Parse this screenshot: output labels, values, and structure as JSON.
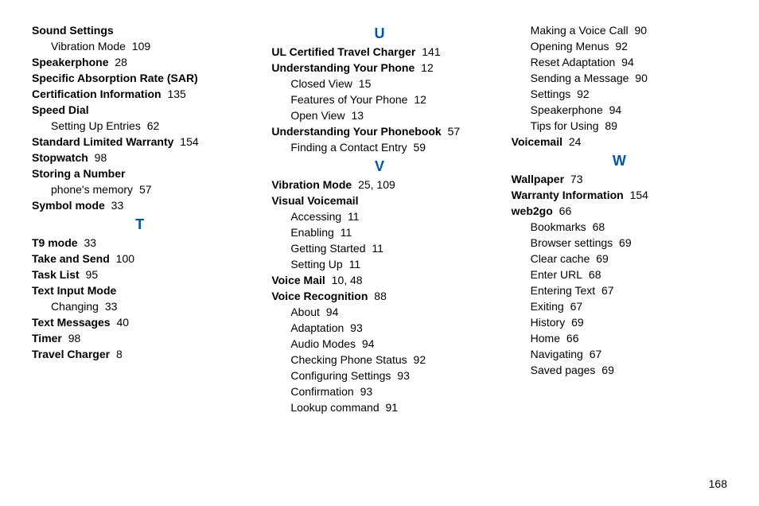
{
  "columns": [
    {
      "blocks": [
        {
          "type": "main",
          "label": "Sound Settings",
          "page": ""
        },
        {
          "type": "sub",
          "label": "Vibration Mode",
          "page": "109"
        },
        {
          "type": "main",
          "label": "Speakerphone",
          "page": "28"
        },
        {
          "type": "main",
          "label": "Specific Absorption Rate (SAR)",
          "page": ""
        },
        {
          "type": "main",
          "label": "Certification Information",
          "page": "135"
        },
        {
          "type": "main",
          "label": "Speed Dial",
          "page": ""
        },
        {
          "type": "sub",
          "label": "Setting Up Entries",
          "page": "62"
        },
        {
          "type": "main",
          "label": "Standard Limited Warranty",
          "page": "154"
        },
        {
          "type": "main",
          "label": "Stopwatch",
          "page": "98"
        },
        {
          "type": "main",
          "label": "Storing a Number",
          "page": ""
        },
        {
          "type": "sub",
          "label": "phone's memory",
          "page": "57"
        },
        {
          "type": "main",
          "label": "Symbol mode",
          "page": "33"
        },
        {
          "type": "letter",
          "label": "T"
        },
        {
          "type": "main",
          "label": "T9 mode",
          "page": "33"
        },
        {
          "type": "main",
          "label": "Take and Send",
          "page": "100"
        },
        {
          "type": "main",
          "label": "Task List",
          "page": "95"
        },
        {
          "type": "main",
          "label": "Text Input Mode",
          "page": ""
        },
        {
          "type": "sub",
          "label": "Changing",
          "page": "33"
        },
        {
          "type": "main",
          "label": "Text Messages",
          "page": "40"
        },
        {
          "type": "main",
          "label": "Timer",
          "page": "98"
        },
        {
          "type": "main",
          "label": "Travel Charger",
          "page": "8"
        }
      ]
    },
    {
      "blocks": [
        {
          "type": "letter",
          "label": "U"
        },
        {
          "type": "main",
          "label": "UL Certified Travel Charger",
          "page": "141"
        },
        {
          "type": "main",
          "label": "Understanding Your Phone",
          "page": "12"
        },
        {
          "type": "sub",
          "label": "Closed View",
          "page": "15"
        },
        {
          "type": "sub",
          "label": "Features of Your Phone",
          "page": "12"
        },
        {
          "type": "sub",
          "label": "Open View",
          "page": "13"
        },
        {
          "type": "main",
          "label": "Understanding Your Phonebook",
          "page": "57"
        },
        {
          "type": "sub",
          "label": "Finding a Contact Entry",
          "page": "59"
        },
        {
          "type": "letter",
          "label": "V"
        },
        {
          "type": "main",
          "label": "Vibration Mode",
          "page": "25,  109"
        },
        {
          "type": "main",
          "label": "Visual Voicemail",
          "page": ""
        },
        {
          "type": "sub",
          "label": "Accessing",
          "page": "11"
        },
        {
          "type": "sub",
          "label": "Enabling",
          "page": "11"
        },
        {
          "type": "sub",
          "label": "Getting Started",
          "page": "11"
        },
        {
          "type": "sub",
          "label": "Setting Up",
          "page": "11"
        },
        {
          "type": "main",
          "label": "Voice Mail",
          "page": "10,  48"
        },
        {
          "type": "main",
          "label": "Voice Recognition",
          "page": "88"
        },
        {
          "type": "sub",
          "label": "About",
          "page": "94"
        },
        {
          "type": "sub",
          "label": "Adaptation",
          "page": "93"
        },
        {
          "type": "sub",
          "label": "Audio Modes",
          "page": "94"
        },
        {
          "type": "sub",
          "label": "Checking Phone Status",
          "page": "92"
        },
        {
          "type": "sub",
          "label": "Configuring Settings",
          "page": "93"
        },
        {
          "type": "sub",
          "label": "Confirmation",
          "page": "93"
        },
        {
          "type": "sub",
          "label": "Lookup command",
          "page": "91"
        }
      ]
    },
    {
      "blocks": [
        {
          "type": "sub",
          "label": "Making a Voice Call",
          "page": "90"
        },
        {
          "type": "sub",
          "label": "Opening Menus",
          "page": "92"
        },
        {
          "type": "sub",
          "label": "Reset Adaptation",
          "page": "94"
        },
        {
          "type": "sub",
          "label": "Sending a Message",
          "page": "90"
        },
        {
          "type": "sub",
          "label": "Settings",
          "page": "92"
        },
        {
          "type": "sub",
          "label": "Speakerphone",
          "page": "94"
        },
        {
          "type": "sub",
          "label": "Tips for Using",
          "page": "89"
        },
        {
          "type": "main",
          "label": "Voicemail",
          "page": "24"
        },
        {
          "type": "letter",
          "label": "W"
        },
        {
          "type": "main",
          "label": "Wallpaper",
          "page": "73"
        },
        {
          "type": "main",
          "label": "Warranty Information",
          "page": "154"
        },
        {
          "type": "main",
          "label": "web2go",
          "page": "66"
        },
        {
          "type": "sub",
          "label": "Bookmarks",
          "page": "68"
        },
        {
          "type": "sub",
          "label": "Browser settings",
          "page": "69"
        },
        {
          "type": "sub",
          "label": "Clear cache",
          "page": "69"
        },
        {
          "type": "sub",
          "label": "Enter URL",
          "page": "68"
        },
        {
          "type": "sub",
          "label": "Entering Text",
          "page": "67"
        },
        {
          "type": "sub",
          "label": "Exiting",
          "page": "67"
        },
        {
          "type": "sub",
          "label": "History",
          "page": "69"
        },
        {
          "type": "sub",
          "label": "Home",
          "page": "66"
        },
        {
          "type": "sub",
          "label": "Navigating",
          "page": "67"
        },
        {
          "type": "sub",
          "label": "Saved pages",
          "page": "69"
        }
      ]
    }
  ],
  "footer_page": "168"
}
